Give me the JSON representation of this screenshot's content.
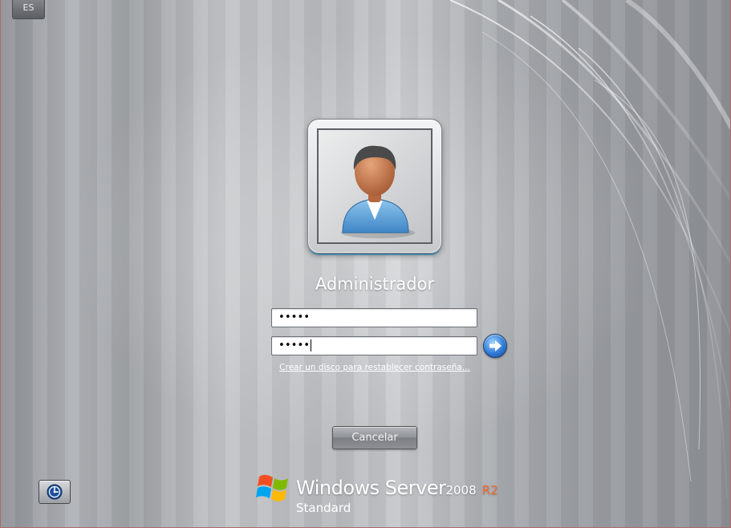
{
  "language_button": {
    "label": "ES"
  },
  "user": {
    "name": "Administrador"
  },
  "fields": {
    "username_value": "•••••",
    "password_value": "•••••"
  },
  "links": {
    "reset_password": "Crear un disco para restablecer contraseña..."
  },
  "buttons": {
    "cancel_label": "Cancelar"
  },
  "branding": {
    "product_name": "Windows Server",
    "version": "2008",
    "release": "R2",
    "edition": "Standard",
    "release_color": "#f26a2f"
  },
  "icons": {
    "user_avatar": "user-avatar-icon",
    "submit_arrow": "arrow-right-icon",
    "ease_of_access": "ease-of-access-icon",
    "windows_flag": "windows-flag-icon"
  }
}
